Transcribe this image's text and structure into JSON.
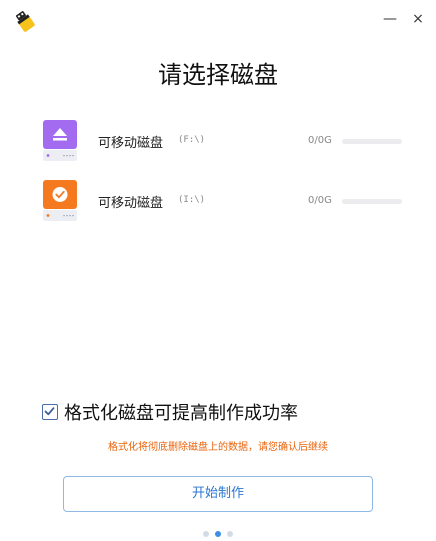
{
  "window": {
    "minimize_glyph": "—",
    "close_glyph": "×"
  },
  "title": "请选择磁盘",
  "disks": [
    {
      "name": "可移动磁盘",
      "letter": "(F:\\)",
      "capacity": "0/0G",
      "usage": 0,
      "icon": "eject-disk-icon",
      "color": "#a36cf0"
    },
    {
      "name": "可移动磁盘",
      "letter": "(I:\\)",
      "capacity": "0/0G",
      "usage": 0,
      "icon": "checked-disk-icon",
      "color": "#f5791f"
    }
  ],
  "format_option": {
    "label": "格式化磁盘可提高制作成功率",
    "checked": true
  },
  "warning": "格式化将彻底删除磁盘上的数据，请您确认后继续",
  "start_button": "开始制作",
  "pager": {
    "count": 3,
    "active": 1
  }
}
